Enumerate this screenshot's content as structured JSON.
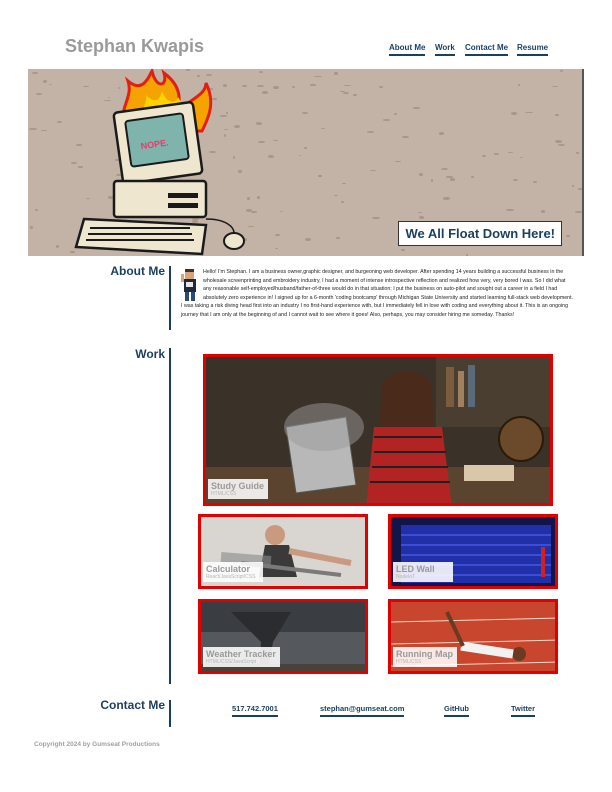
{
  "header": {
    "site_title": "Stephan Kwapis",
    "nav": [
      {
        "label": "About Me"
      },
      {
        "label": "Work"
      },
      {
        "label": "Contact Me"
      },
      {
        "label": "Resume"
      }
    ]
  },
  "hero": {
    "screen_text": "NOPE.",
    "tagline": "We All Float Down Here!"
  },
  "about": {
    "heading": "About Me",
    "text": "Hello! I'm Stephan. I am a business owner,graphic designer, and burgeoning web developer. After spending 14 years building a successful business in the wholesale screenprinting and embroidery industry, I had a moment of intense introspective reflection and realized how very, very bored I was. So I did what any reasonable self-employed/husband/father-of-three would do in that situation; I put the business on auto-pilot and sought out a career in a field I had absolutely zero experience in! I signed up for a 6-month 'coding bootcamp' through Michigan State University and started learning full-stack web development. I was taking a risk diving head first into an industry I no first-hand experience with, but I immediately fell in love with coding and everything about it. This is an ongoing journey that I am only at the beginning of and I cannot wait to see where it goes! Also, perhaps, you may consider hiring me someday. Thanks!"
  },
  "work": {
    "heading": "Work",
    "projects": [
      {
        "title": "Study Guide",
        "tech": "HTML/CSS"
      },
      {
        "title": "Calculator",
        "tech": "React/JavaScript/CSS"
      },
      {
        "title": "LED Wall",
        "tech": "NodeIoT"
      },
      {
        "title": "Weather Tracker",
        "tech": "HTML/CSS/JavaScript"
      },
      {
        "title": "Running Map",
        "tech": "HTML/CSS"
      }
    ]
  },
  "contact": {
    "heading": "Contact Me",
    "links": [
      {
        "label": "517.742.7001"
      },
      {
        "label": "stephan@gumseat.com"
      },
      {
        "label": "GitHub"
      },
      {
        "label": "Twitter"
      }
    ]
  },
  "footer": {
    "copyright": "Copyright 2024 by Gumseat Productions"
  },
  "colors": {
    "accent": "#1c3f5e",
    "card_border": "#e00000",
    "hero_bg": "#c3b2a6"
  }
}
